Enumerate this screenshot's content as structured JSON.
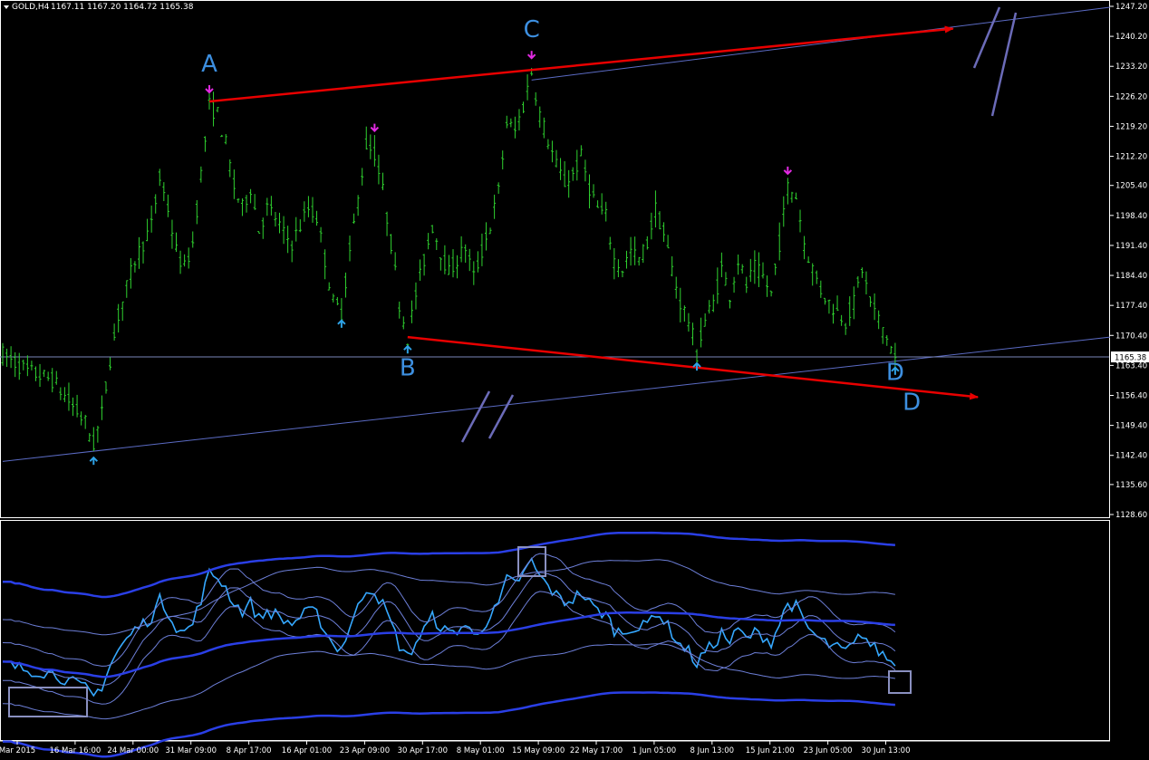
{
  "header": {
    "symbol": "GOLD,H4",
    "ohlc": "1167.11 1167.20 1164.72 1165.38",
    "arrow_icon": "triangle-down-icon"
  },
  "price_panel": {
    "y_ticks": [
      "1247.20",
      "1240.20",
      "1233.20",
      "1226.20",
      "1219.20",
      "1212.20",
      "1205.40",
      "1198.40",
      "1191.40",
      "1184.40",
      "1177.40",
      "1170.40",
      "1163.40",
      "1156.40",
      "1149.40",
      "1142.40",
      "1135.60",
      "1128.60"
    ],
    "current_price_label": "1165.38",
    "ylim": [
      1128.6,
      1247.2
    ]
  },
  "x_ticks": [
    "Mar 2015",
    "16 Mar 16:00",
    "24 Mar 00:00",
    "31 Mar 09:00",
    "8 Apr 17:00",
    "16 Apr 01:00",
    "23 Apr 09:00",
    "30 Apr 17:00",
    "8 May 01:00",
    "15 May 09:00",
    "22 May 17:00",
    "1 Jun 05:00",
    "8 Jun 13:00",
    "15 Jun 21:00",
    "23 Jun 05:00",
    "30 Jun 13:00"
  ],
  "annotations": {
    "labels": [
      "A",
      "B",
      "C",
      "D",
      "D"
    ],
    "label_color": "#3d8fe0"
  },
  "colors": {
    "candles": "#2fd12f",
    "trend_arrow": "#e80000",
    "channel_line": "#5b6bc4",
    "up_fractal": "#2ea2e6",
    "down_fractal": "#e22ae2",
    "osc_line": "#35a8ff",
    "bands_thick": "#2a3fe6",
    "bands_thin": "#6d7fd8",
    "marker_box": "#8a90c0",
    "axis": "#ffffff"
  },
  "chart_data": {
    "type": "candlestick",
    "symbol": "GOLD",
    "timeframe": "H4",
    "last": {
      "open": 1167.11,
      "high": 1167.2,
      "low": 1164.72,
      "close": 1165.38
    },
    "ylim": [
      1128.6,
      1247.2
    ],
    "x_categories": [
      "Mar 2015",
      "16 Mar 16:00",
      "24 Mar 00:00",
      "31 Mar 09:00",
      "8 Apr 17:00",
      "16 Apr 01:00",
      "23 Apr 09:00",
      "30 Apr 17:00",
      "8 May 01:00",
      "15 May 09:00",
      "22 May 17:00",
      "1 Jun 05:00",
      "8 Jun 13:00",
      "15 Jun 21:00",
      "23 Jun 05:00",
      "30 Jun 13:00"
    ],
    "price_path": [
      [
        0,
        1166
      ],
      [
        3,
        1162
      ],
      [
        6,
        1160
      ],
      [
        8,
        1155
      ],
      [
        10,
        1150
      ],
      [
        11,
        1145
      ],
      [
        12,
        1152
      ],
      [
        13,
        1165
      ],
      [
        14,
        1175
      ],
      [
        16,
        1188
      ],
      [
        18,
        1196
      ],
      [
        19,
        1207
      ],
      [
        20,
        1200
      ],
      [
        21,
        1190
      ],
      [
        22,
        1186
      ],
      [
        23,
        1192
      ],
      [
        24,
        1208
      ],
      [
        25,
        1224
      ],
      [
        26,
        1222
      ],
      [
        27,
        1215
      ],
      [
        28,
        1205
      ],
      [
        29,
        1200
      ],
      [
        30,
        1205
      ],
      [
        31,
        1195
      ],
      [
        32,
        1200
      ],
      [
        33,
        1198
      ],
      [
        34,
        1194
      ],
      [
        35,
        1192
      ],
      [
        36,
        1196
      ],
      [
        37,
        1200
      ],
      [
        38,
        1198
      ],
      [
        39,
        1188
      ],
      [
        40,
        1178
      ],
      [
        41,
        1176
      ],
      [
        42,
        1190
      ],
      [
        43,
        1202
      ],
      [
        44,
        1215
      ],
      [
        45,
        1213
      ],
      [
        46,
        1204
      ],
      [
        47,
        1192
      ],
      [
        48,
        1178
      ],
      [
        49,
        1170
      ],
      [
        50,
        1180
      ],
      [
        51,
        1188
      ],
      [
        52,
        1196
      ],
      [
        53,
        1190
      ],
      [
        54,
        1185
      ],
      [
        55,
        1188
      ],
      [
        56,
        1191
      ],
      [
        57,
        1184
      ],
      [
        58,
        1190
      ],
      [
        59,
        1196
      ],
      [
        60,
        1204
      ],
      [
        61,
        1220
      ],
      [
        62,
        1218
      ],
      [
        63,
        1224
      ],
      [
        64,
        1232
      ],
      [
        65,
        1222
      ],
      [
        66,
        1216
      ],
      [
        67,
        1210
      ],
      [
        68,
        1206
      ],
      [
        69,
        1208
      ],
      [
        70,
        1212
      ],
      [
        71,
        1205
      ],
      [
        72,
        1200
      ],
      [
        73,
        1198
      ],
      [
        74,
        1188
      ],
      [
        75,
        1186
      ],
      [
        76,
        1190
      ],
      [
        77,
        1188
      ],
      [
        78,
        1192
      ],
      [
        79,
        1200
      ],
      [
        80,
        1194
      ],
      [
        81,
        1186
      ],
      [
        82,
        1178
      ],
      [
        83,
        1174
      ],
      [
        84,
        1166
      ],
      [
        85,
        1174
      ],
      [
        86,
        1178
      ],
      [
        87,
        1186
      ],
      [
        88,
        1180
      ],
      [
        89,
        1188
      ],
      [
        90,
        1182
      ],
      [
        91,
        1186
      ],
      [
        92,
        1184
      ],
      [
        93,
        1180
      ],
      [
        94,
        1192
      ],
      [
        95,
        1205
      ],
      [
        96,
        1203
      ],
      [
        97,
        1192
      ],
      [
        98,
        1186
      ],
      [
        99,
        1181
      ],
      [
        100,
        1178
      ],
      [
        101,
        1176
      ],
      [
        102,
        1174
      ],
      [
        103,
        1178
      ],
      [
        104,
        1186
      ],
      [
        105,
        1178
      ],
      [
        106,
        1174
      ],
      [
        107,
        1170
      ],
      [
        108,
        1165
      ]
    ],
    "fractals_up": [
      [
        11,
        1144
      ],
      [
        41,
        1176
      ],
      [
        49,
        1170
      ],
      [
        84,
        1166
      ],
      [
        108,
        1165
      ]
    ],
    "fractals_down": [
      [
        25,
        1225
      ],
      [
        45,
        1216
      ],
      [
        64,
        1233
      ],
      [
        95,
        1206
      ]
    ],
    "trend_lines": [
      {
        "from": [
          25,
          1225
        ],
        "to": [
          115,
          1242
        ]
      },
      {
        "from": [
          49,
          1170
        ],
        "to": [
          118,
          1156
        ]
      }
    ],
    "channel_line": {
      "from": [
        0,
        1141
      ],
      "to": [
        134,
        1170
      ]
    },
    "channel_line_upper": {
      "from": [
        64,
        1230
      ],
      "to": [
        134,
        1247
      ]
    },
    "point_labels": [
      {
        "text": "A",
        "at": [
          25,
          1232
        ]
      },
      {
        "text": "B",
        "at": [
          49,
          1161
        ]
      },
      {
        "text": "C",
        "at": [
          64,
          1240
        ]
      },
      {
        "text": "D",
        "at": [
          108,
          1160
        ]
      },
      {
        "text": "D",
        "at": [
          110,
          1153
        ]
      }
    ]
  }
}
